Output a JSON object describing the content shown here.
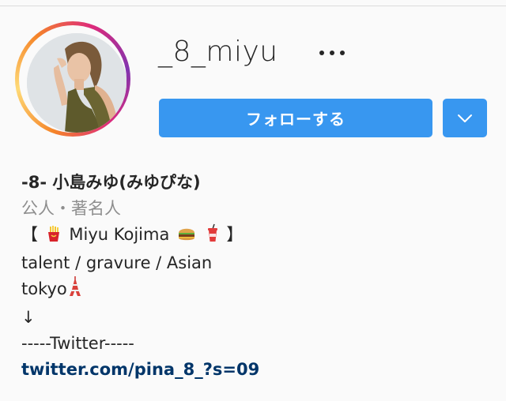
{
  "profile": {
    "username": "_8_miyu",
    "more_icon": "ellipsis-horizontal-icon",
    "follow_label": "フォローする",
    "dropdown_icon": "chevron-down-icon",
    "display_name": "-8- 小島みゆ(みゆぴな)",
    "category": "公人・著名人",
    "bio": {
      "line1_open": "【",
      "line1_emoji_1": "french-fries-emoji",
      "line1_text": "Miyu Kojima",
      "line1_emoji_2": "hamburger-emoji",
      "line1_emoji_3": "cup-with-straw-emoji",
      "line1_close": "】",
      "line2": "talent / gravure / Asian",
      "line3_text": "tokyo",
      "line3_emoji": "tokyo-tower-emoji",
      "line4": "↓",
      "line5": "-----Twitter-----",
      "link": "twitter.com/pina_8_?s=09"
    }
  },
  "colors": {
    "accent": "#3897f0",
    "link": "#003569",
    "muted": "#8e8e8e",
    "text": "#262626",
    "background": "#fafafa"
  }
}
